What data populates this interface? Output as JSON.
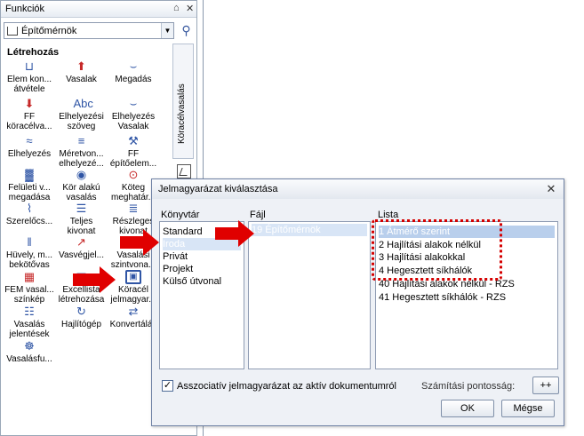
{
  "palette": {
    "title": "Funkciók",
    "pin_glyph": "⌂",
    "close_glyph": "✕",
    "combo_value": "Építőmérnök",
    "section_title": "Létrehozás",
    "side_tab_label": "Köracélvasalás",
    "tools": [
      {
        "label": "Elem kon... átvétele",
        "icon": "mold-icon",
        "glyph": "⊔"
      },
      {
        "label": "Vasalak",
        "icon": "rebar-shape-icon",
        "glyph": "⬆"
      },
      {
        "label": "Megadás",
        "icon": "define-icon",
        "glyph": "⌣"
      },
      {
        "label": "FF köracélva...",
        "icon": "ff-rebar-icon",
        "glyph": "⬇"
      },
      {
        "label": "Elhelyezési szöveg",
        "icon": "placement-text-icon",
        "glyph": "Abc"
      },
      {
        "label": "Elhelyezés Vasalak",
        "icon": "place-shape-icon",
        "glyph": "⌣"
      },
      {
        "label": "Elhelyezés",
        "icon": "placement-icon",
        "glyph": "≈"
      },
      {
        "label": "Méretvon... elhelyezé...",
        "icon": "dimension-line-icon",
        "glyph": "≡"
      },
      {
        "label": "FF építőelem...",
        "icon": "ff-element-icon",
        "glyph": "⚒"
      },
      {
        "label": "Felületi v... megadása",
        "icon": "surface-rebar-icon",
        "glyph": "▓"
      },
      {
        "label": "Kör alakú vasalás",
        "icon": "circular-rebar-icon",
        "glyph": "◉"
      },
      {
        "label": "Köteg meghatár...",
        "icon": "bundle-icon",
        "glyph": "⊙"
      },
      {
        "label": "Szerelőcs...",
        "icon": "mounting-icon",
        "glyph": "⌇"
      },
      {
        "label": "Teljes kivonat",
        "icon": "full-extract-icon",
        "glyph": "☰"
      },
      {
        "label": "Részleges kivonat",
        "icon": "partial-extract-icon",
        "glyph": "≣"
      },
      {
        "label": "Hüvely, m... bekötővas",
        "icon": "sleeve-icon",
        "glyph": "‖"
      },
      {
        "label": "Vasvégjel...",
        "icon": "bar-end-icon",
        "glyph": "↗"
      },
      {
        "label": "Vasalási szintvona...",
        "icon": "rebar-level-icon",
        "glyph": "═"
      },
      {
        "label": "FEM vasal... színkép",
        "icon": "fem-spectrum-icon",
        "glyph": "▦"
      },
      {
        "label": "Excellista létrehozása",
        "icon": "excel-list-icon",
        "glyph": "▤"
      },
      {
        "label": "Köracél jelmagyar...",
        "icon": "rebar-legend-icon",
        "glyph": "▣"
      },
      {
        "label": "Vasalás jelentések",
        "icon": "rebar-report-icon",
        "glyph": "☷"
      },
      {
        "label": "Hajlítógép",
        "icon": "bending-machine-icon",
        "glyph": "↻"
      },
      {
        "label": "Konvertálás",
        "icon": "convert-icon",
        "glyph": "⇄"
      },
      {
        "label": "Vasalásfu...",
        "icon": "rebar-function-icon",
        "glyph": "☸"
      }
    ]
  },
  "dialog": {
    "title": "Jelmagyarázat kiválasztása",
    "close_glyph": "✕",
    "library": {
      "label": "Könyvtár",
      "items": [
        "Standard",
        "Iroda",
        "Privát",
        "Projekt",
        "Külső útvonal"
      ]
    },
    "file": {
      "label": "Fájl",
      "items": [
        "19 Építőmérnök"
      ]
    },
    "list": {
      "label": "Lista",
      "items": [
        "1 Átmérő szerint",
        "2 Hajlítási alakok nélkül",
        "3 Hajlítási alakokkal",
        "4 Hegesztett síkhálók",
        "40 Hajlítási alakok nélkül - RZS",
        "41 Hegesztett síkhálók - RZS"
      ]
    },
    "associative_checkbox_checked": true,
    "associative_label": "Asszociatív jelmagyarázat az aktív dokumentumról",
    "precision_label": "Számítási pontosság:",
    "precision_button": "++",
    "ok_label": "OK",
    "cancel_label": "Mégse"
  },
  "annotations": {
    "arrow_color": "#e00000",
    "highlight_color": "#d50000"
  }
}
